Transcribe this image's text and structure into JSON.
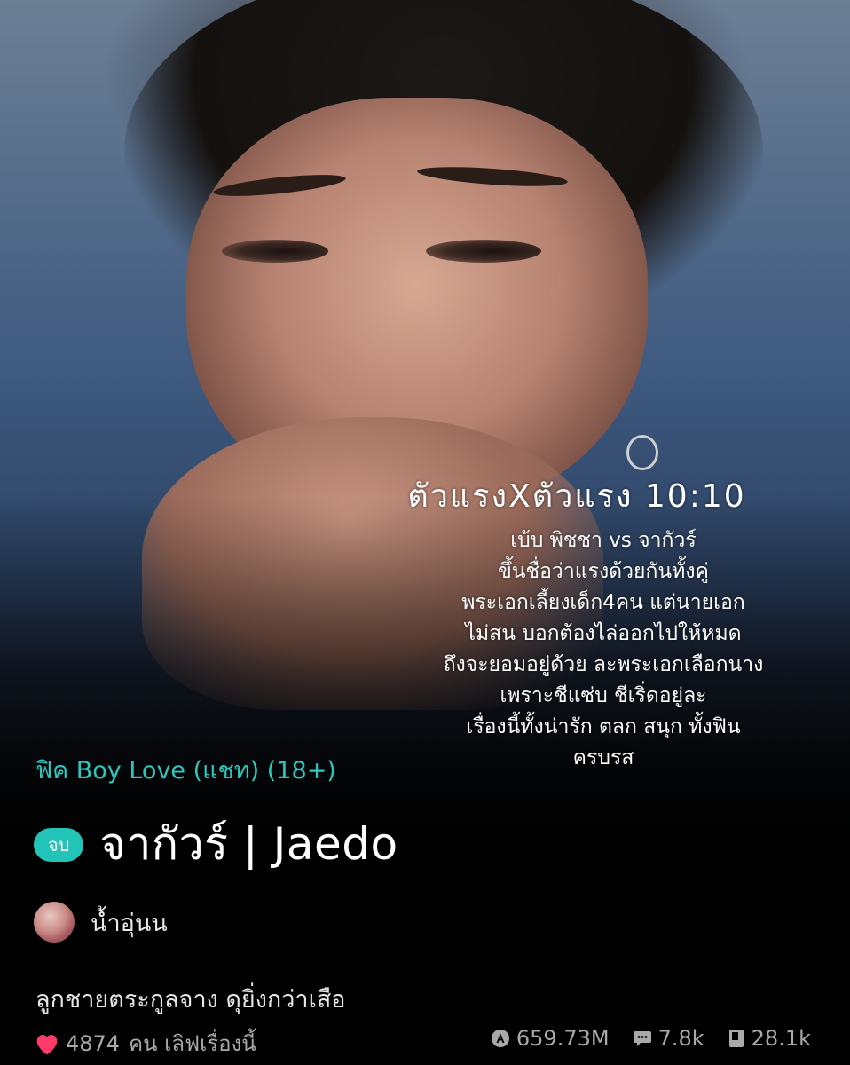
{
  "cover": {
    "overlay_title": "ตัวแรงXตัวแรง 10:10",
    "overlay_blurb": [
      "เบ้บ พิชชา vs จากัวร์",
      "ขึ้นชื่อว่าแรงด้วยกันทั้งคู่",
      "พระเอกเลี้ยงเด็ก4คน แต่นายเอก",
      "ไม่สน บอกต้องไล่ออกไปให้หมด",
      "ถึงจะยอมอยู่ด้วย ละพระเอกเลือกนาง",
      "เพราะชีแซ่บ ชีเริ่ดอยู่ละ",
      "เรื่องนี้ทั้งน่ารัก ตลก สนุก ทั้งฟิน",
      "ครบรส"
    ]
  },
  "story": {
    "category": "ฟิค Boy Love (แชท) (18+)",
    "status_badge": "จบ",
    "title": "จากัวร์ | Jaedo",
    "author": "น้ำอุ่นน",
    "synopsis": "ลูกชายตระกูลจาง ดุยิ่งกว่าเสือ"
  },
  "stats": {
    "likes_count": "4874",
    "likes_label": "คน เลิฟเรื่องนี้",
    "views": "659.73M",
    "comments": "7.8k",
    "chapters": "28.1k"
  },
  "colors": {
    "accent": "#2ec7bd",
    "badge": "#23c4b8",
    "heart": "#ff3b6b",
    "muted": "#a9a9a9"
  },
  "icons": {
    "likes": "heart-icon",
    "views": "views-icon",
    "comments": "comment-icon",
    "chapters": "book-icon"
  }
}
